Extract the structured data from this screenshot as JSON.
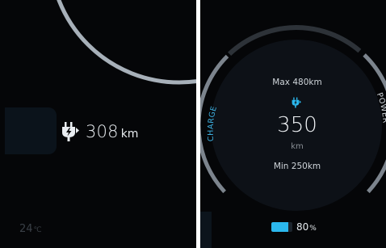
{
  "left_panel": {
    "range": {
      "value": "308",
      "unit": "km",
      "icon": "charging-plug-icon"
    },
    "temperature": {
      "value": "24",
      "unit": "℃"
    }
  },
  "right_panel": {
    "gauge": {
      "max_label": "Max 480km",
      "min_label": "Min 250km",
      "value": "350",
      "unit": "km",
      "left_arc_label": "CHARGE",
      "right_arc_label": "POWER",
      "icon": "charging-plug-icon"
    },
    "battery": {
      "level": 0.8,
      "value": "80",
      "unit": "%"
    }
  },
  "colors": {
    "background": "#050608",
    "accent": "#2bb8ee",
    "arc": "#a7b0b9",
    "text": "#e9edf1"
  }
}
